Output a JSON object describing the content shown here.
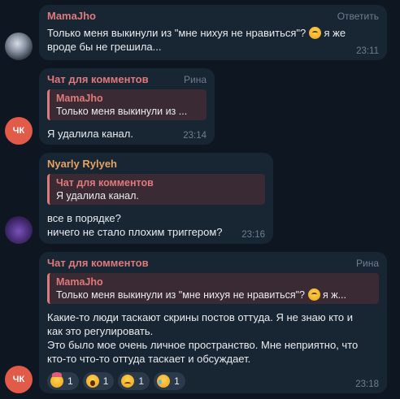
{
  "messages": [
    {
      "sender": "MamaJho",
      "side": "Ответить",
      "text": "Только меня выкинули из \"мне нихуя не нравиться\"? 🥺 я же вроде бы не грешила...",
      "text_line1": "Только меня выкинули из \"мне нихуя не нравиться\"?",
      "text_line1_tail": "я же",
      "text_line2": "вроде бы не грешила...",
      "time": "23:11"
    },
    {
      "sender": "Чат для комментов",
      "side": "Рина",
      "avatar": "ЧК",
      "reply_name": "MamaJho",
      "reply_text": "Только меня выкинули из ...",
      "text": "Я удалила канал.",
      "time": "23:14"
    },
    {
      "sender": "Nyarly Rylyeh",
      "reply_name": "Чат для комментов",
      "reply_text": "Я удалила канал.",
      "text_line1": "все в порядке?",
      "text_line2": "ничего не стало плохим триггером?",
      "time": "23:16"
    },
    {
      "sender": "Чат для комментов",
      "side": "Рина",
      "avatar": "ЧК",
      "reply_name": "MamaJho",
      "reply_text": "Только меня выкинули из \"мне нихуя не нравиться\"?",
      "reply_text_tail": "я ж...",
      "text_line1": "Какие-то люди таскают скрины постов оттуда. Я не знаю кто и",
      "text_line2": "как это регулировать.",
      "text_line3": "Это было мое очень личное пространство. Мне неприятно, что",
      "text_line4": "кто-то что-то оттуда таскает и обсуждает.",
      "reactions": [
        {
          "icon": "party-face-icon",
          "count": "1"
        },
        {
          "icon": "screaming-face-icon",
          "count": "1"
        },
        {
          "icon": "sad-face-icon",
          "count": "1"
        },
        {
          "icon": "crying-face-icon",
          "count": "1"
        }
      ],
      "time": "23:18"
    }
  ]
}
